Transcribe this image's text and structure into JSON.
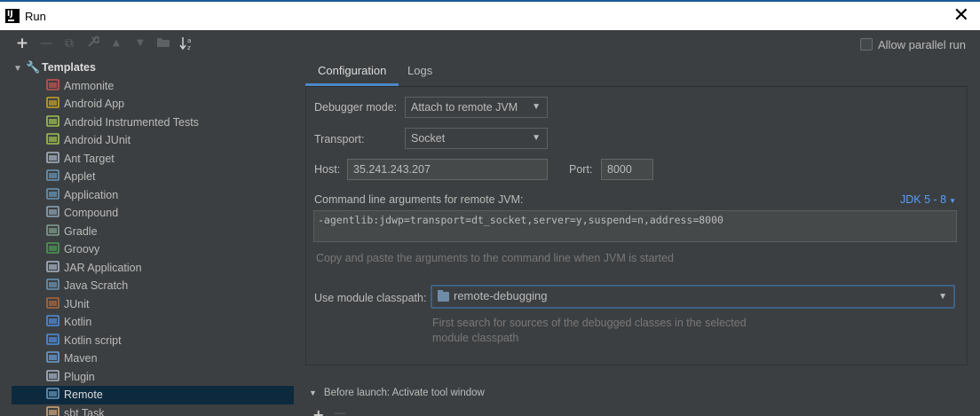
{
  "window": {
    "title": "Run",
    "close_glyph": "✕"
  },
  "toolbar": {
    "add": "+",
    "remove": "—",
    "copy": "⧉",
    "edit": "🔧",
    "up": "▲",
    "down": "▼",
    "folder": "▣",
    "sort": "↓ᵃᶻ"
  },
  "tree": {
    "root_label": "Templates",
    "items": [
      {
        "label": "Ammonite",
        "icon": "ammonite-icon",
        "color": "#c75450"
      },
      {
        "label": "Android App",
        "icon": "android-app-icon",
        "color": "#c9a227"
      },
      {
        "label": "Android Instrumented Tests",
        "icon": "android-tests-icon",
        "color": "#9fc34f"
      },
      {
        "label": "Android JUnit",
        "icon": "android-junit-icon",
        "color": "#9fc34f"
      },
      {
        "label": "Ant Target",
        "icon": "ant-icon",
        "color": "#a9b7c6"
      },
      {
        "label": "Applet",
        "icon": "applet-icon",
        "color": "#6897bb"
      },
      {
        "label": "Application",
        "icon": "application-icon",
        "color": "#6897bb"
      },
      {
        "label": "Compound",
        "icon": "compound-icon",
        "color": "#8fa6b8"
      },
      {
        "label": "Gradle",
        "icon": "gradle-icon",
        "color": "#7f9f8f"
      },
      {
        "label": "Groovy",
        "icon": "groovy-icon",
        "color": "#499c54"
      },
      {
        "label": "JAR Application",
        "icon": "jar-icon",
        "color": "#a9b7c6"
      },
      {
        "label": "Java Scratch",
        "icon": "java-scratch-icon",
        "color": "#6897bb"
      },
      {
        "label": "JUnit",
        "icon": "junit-icon",
        "color": "#b06a3a"
      },
      {
        "label": "Kotlin",
        "icon": "kotlin-icon",
        "color": "#4f8fdf"
      },
      {
        "label": "Kotlin script",
        "icon": "kotlin-script-icon",
        "color": "#4f8fdf"
      },
      {
        "label": "Maven",
        "icon": "maven-icon",
        "color": "#6a9fd8"
      },
      {
        "label": "Plugin",
        "icon": "plugin-icon",
        "color": "#a9b7c6"
      },
      {
        "label": "Remote",
        "icon": "remote-icon",
        "color": "#6897bb"
      },
      {
        "label": "sbt Task",
        "icon": "sbt-icon",
        "color": "#d0a87a"
      }
    ],
    "selected_index": 17
  },
  "allow_parallel": {
    "label": "Allow parallel run"
  },
  "tabs": [
    {
      "label": "Configuration",
      "active": true
    },
    {
      "label": "Logs",
      "active": false
    }
  ],
  "form": {
    "debugger_mode_label": "Debugger mode:",
    "debugger_mode_value": "Attach to remote JVM",
    "transport_label": "Transport:",
    "transport_value": "Socket",
    "host_label": "Host:",
    "host_value": "35.241.243.207",
    "port_label": "Port:",
    "port_value": "8000",
    "cmd_label": "Command line arguments for remote JVM:",
    "jdk_link": "JDK 5 - 8",
    "cmd_value": "-agentlib:jdwp=transport=dt_socket,server=y,suspend=n,address=8000",
    "cmd_hint": "Copy and paste the arguments to the command line when JVM is started",
    "module_label": "Use module classpath:",
    "module_value": "remote-debugging",
    "module_hint_1": "First search for sources of the debugged classes in the selected",
    "module_hint_2": "module classpath"
  },
  "before_launch": {
    "label": "Before launch: Activate tool window"
  },
  "colors": {
    "accent": "#4a88c7",
    "link": "#589df6",
    "selection": "#0d293e",
    "background": "#3c3f41"
  }
}
